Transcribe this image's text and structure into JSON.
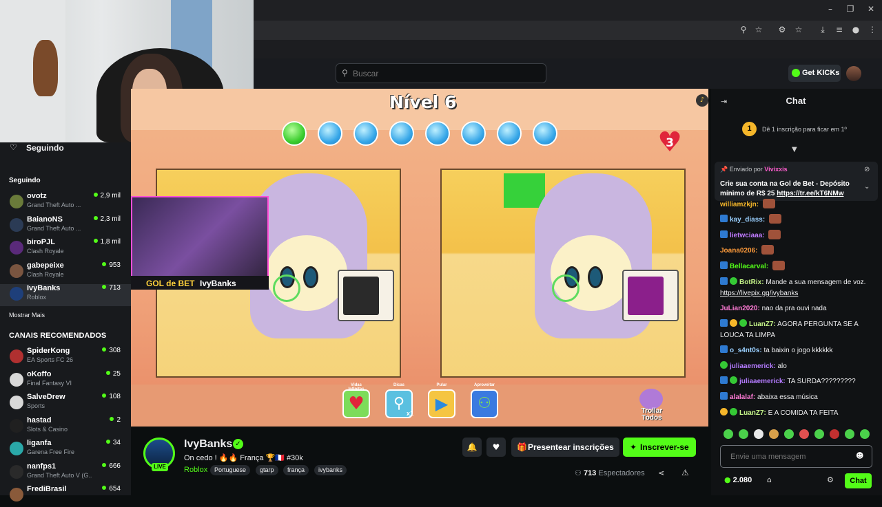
{
  "header": {
    "search_placeholder": "Buscar",
    "get_kicks_label": "Get KICKs"
  },
  "sidebar": {
    "title": "Seguindo",
    "following_section": "Seguindo",
    "following": [
      {
        "name": "ovotz",
        "game": "Grand Theft Auto ...",
        "viewers": "2,9 mil",
        "avatar": "#6a7b3a"
      },
      {
        "name": "BaianoNS",
        "game": "Grand Theft Auto ...",
        "viewers": "2,3 mil",
        "avatar": "#2b3b55"
      },
      {
        "name": "biroPJL",
        "game": "Clash Royale",
        "viewers": "1,8 mil",
        "avatar": "#5a2a7a"
      },
      {
        "name": "gabepeixe",
        "game": "Clash Royale",
        "viewers": "953",
        "avatar": "#7a5540"
      },
      {
        "name": "IvyBanks",
        "game": "Roblox",
        "viewers": "713",
        "avatar": "#1e3f7a"
      }
    ],
    "show_more": "Mostrar Mais",
    "recommended_section": "CANAIS RECOMENDADOS",
    "recommended": [
      {
        "name": "SpiderKong",
        "game": "EA Sports FC 26",
        "viewers": "308",
        "avatar": "#b03030"
      },
      {
        "name": "oKoffo",
        "game": "Final Fantasy VI",
        "viewers": "25",
        "avatar": "#d8d8d8"
      },
      {
        "name": "SalveDrew",
        "game": "Sports",
        "viewers": "108",
        "avatar": "#d8d8d8"
      },
      {
        "name": "hastad",
        "game": "Slots & Casino",
        "viewers": "2",
        "avatar": "#202020"
      },
      {
        "name": "liganfa",
        "game": "Garena Free Fire",
        "viewers": "34",
        "avatar": "#2aa8a8"
      },
      {
        "name": "nanfps1",
        "game": "Grand Theft Auto V (G...",
        "viewers": "666",
        "avatar": "#2a2a2a"
      },
      {
        "name": "FrediBrasil",
        "game": "",
        "viewers": "654",
        "avatar": "#8a5a3a"
      }
    ]
  },
  "game": {
    "level_label": "Nível 6",
    "lives": "3",
    "powerups": [
      {
        "label": "Vidas Infinitas"
      },
      {
        "label": "Dicas",
        "count": "x1"
      },
      {
        "label": "Pular"
      },
      {
        "label": "Aproveitar"
      }
    ],
    "troll_label": "Trollar Todos",
    "pip_logo": "GOL de BET",
    "pip_name": "IvyBanks"
  },
  "stream": {
    "channel_name": "IvyBanks",
    "live_badge": "LIVE",
    "title": "On cedo ! 🔥🔥 França 🏆🇫🇷 #30k",
    "category": "Roblox",
    "tags": [
      "Portuguese",
      "gtarp",
      "frança",
      "ivybanks"
    ],
    "gift_label": "Presentear inscrições",
    "subscribe_label": "Inscrever-se",
    "viewer_count": "713",
    "viewer_label": "Espectadores"
  },
  "chat": {
    "title": "Chat",
    "goal_number": "1",
    "goal_text": "Dê 1 inscrição para ficar em 1º",
    "pinned": {
      "sent_by_label": "Enviado por",
      "user": "Vivixxis",
      "message": "Crie sua conta na Gol de Bet - Depósito mínimo de R$ 25",
      "link": "https://tr.ee/kT6NMw"
    },
    "messages": [
      {
        "user": "williamzkjn:",
        "color": "#f5b62a",
        "text": "",
        "emote": true
      },
      {
        "user": "kay_diass:",
        "color": "#9ad0ff",
        "text": "",
        "emote": true
      },
      {
        "user": "lietwciaaa:",
        "color": "#c07bff",
        "text": "",
        "emote": true
      },
      {
        "user": "Joana0206:",
        "color": "#ff9b3b",
        "text": "",
        "emote": true
      },
      {
        "user": "Bellacarval:",
        "color": "#53fc18",
        "text": "",
        "emote": true
      },
      {
        "user": "BotRix:",
        "color": "#c6f58a",
        "text": "Mande a sua mensagem de voz.",
        "link": "https://livepix.gg/ivybanks"
      },
      {
        "user": "JuLian2020:",
        "color": "#ff7bd6",
        "text": "nao da pra ouvi nada"
      },
      {
        "user": "LuanZ7:",
        "color": "#c6f58a",
        "text": "AGORA PERGUNTA SE A LOUCA TA LIMPA"
      },
      {
        "user": "o_s4nt0s:",
        "color": "#9ad0ff",
        "text": "ta baixin o jogo kkkkkk"
      },
      {
        "user": "juliaaemerick:",
        "color": "#b47bff",
        "text": "alo"
      },
      {
        "user": "juliaaemerick:",
        "color": "#b47bff",
        "text": "TA SURDA?????????"
      },
      {
        "user": "alalalaf:",
        "color": "#ff7bd6",
        "text": "abaixa essa música"
      },
      {
        "user": "LuanZ7:",
        "color": "#c6f58a",
        "text": "E A COMIDA TA FEITA"
      }
    ],
    "input_placeholder": "Envie uma mensagem",
    "kicks_balance": "2.080",
    "send_label": "Chat"
  }
}
